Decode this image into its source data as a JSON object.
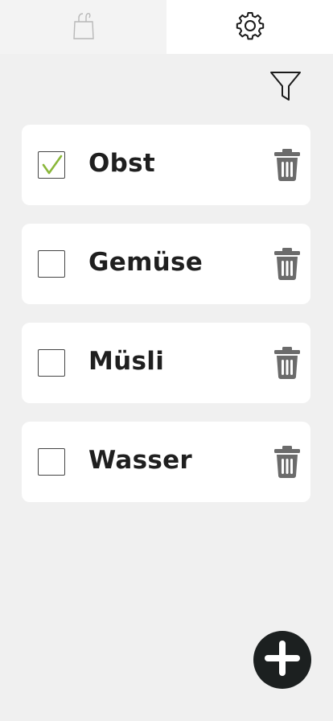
{
  "tabs": [
    {
      "name": "bag-tab",
      "icon": "shopping-bag-icon",
      "active": false
    },
    {
      "name": "settings-tab",
      "icon": "gear-icon",
      "active": true
    }
  ],
  "toolbar": {
    "filter_icon": "filter-icon"
  },
  "items": [
    {
      "label": "Obst",
      "checked": true
    },
    {
      "label": "Gemüse",
      "checked": false
    },
    {
      "label": "Müsli",
      "checked": false
    },
    {
      "label": "Wasser",
      "checked": false
    }
  ],
  "fab": {
    "icon": "plus-icon"
  },
  "colors": {
    "check": "#8ab73a",
    "trash": "#6b6b6b",
    "fab": "#1c2020",
    "background": "#f0f0f0"
  }
}
